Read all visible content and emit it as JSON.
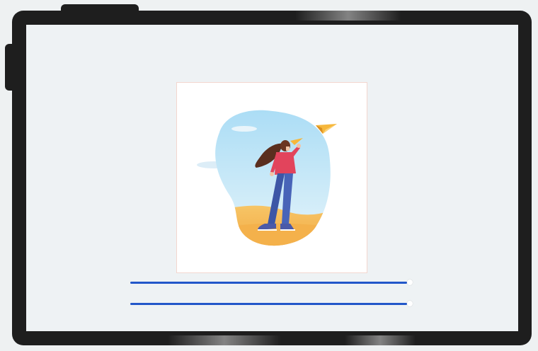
{
  "device": {
    "frame_color": "#1e1e1e",
    "screen_color": "#eef2f4"
  },
  "image": {
    "icon": "woman-with-paper-plane-illustration"
  },
  "sliders": [
    {
      "name": "slider-1",
      "value_percent": 100,
      "track_color": "#2257c9"
    },
    {
      "name": "slider-2",
      "value_percent": 100,
      "track_color": "#2257c9"
    }
  ]
}
